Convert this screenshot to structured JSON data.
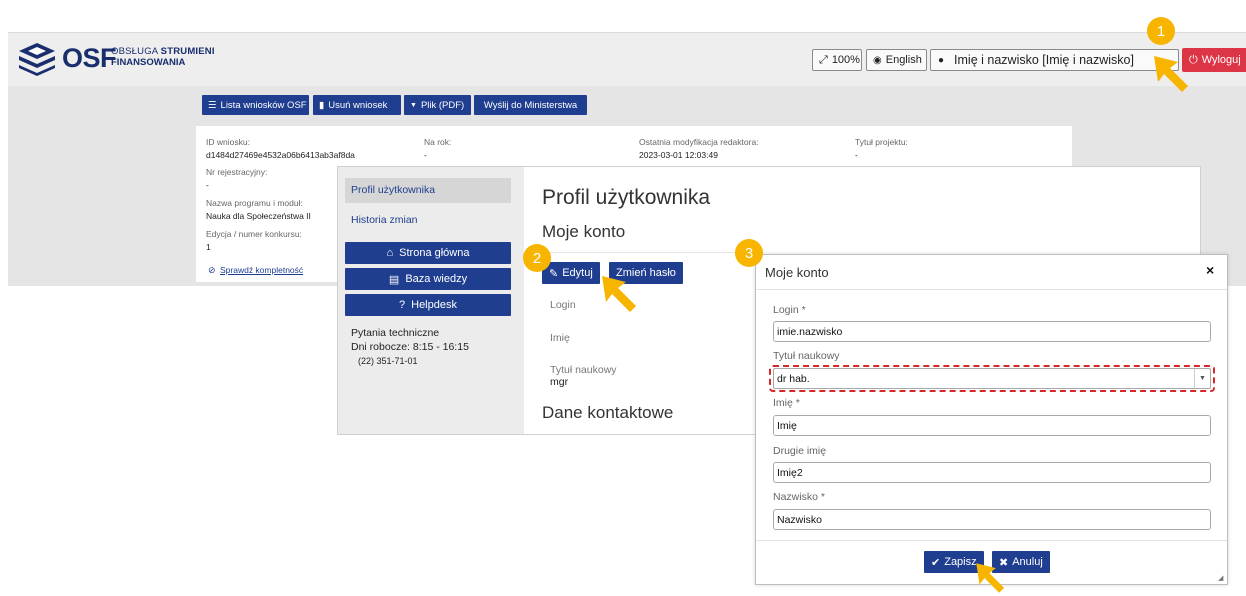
{
  "header": {
    "logo_text": "OSF",
    "logo_line1_light": "OBSŁUGA ",
    "logo_line1_bold": "STRUMIENI",
    "logo_line2": "FINANSOWANIA",
    "zoom": "100%",
    "language": "English",
    "user": "Imię i nazwisko [Imię i nazwisko]",
    "logout": "Wyloguj"
  },
  "toolbar": {
    "list": "Lista wniosków OSF",
    "delete": "Usuń wniosek",
    "file": "Plik (PDF)",
    "send": "Wyślij do Ministerstwa"
  },
  "info": {
    "id_label": "ID wniosku:",
    "id_value": "d1484d27469e4532a06b6413ab3af8da",
    "year_label": "Na rok:",
    "year_value": "-",
    "modified_label": "Ostatnia modyfikacja redaktora:",
    "modified_value": "2023-03-01 12:03:49",
    "project_label": "Tytuł projektu:",
    "project_value": "-",
    "reg_label": "Nr rejestracyjny:",
    "reg_value": "-",
    "program_label": "Nazwa programu i moduł:",
    "program_value": "Nauka dla Społeczeństwa II",
    "edition_label": "Edycja / numer konkursu:",
    "edition_value": "1",
    "check_link": "Sprawdź kompletność"
  },
  "sidebar": {
    "profile": "Profil użytkownika",
    "history": "Historia zmian",
    "home": "Strona główna",
    "knowledge": "Baza wiedzy",
    "helpdesk": "Helpdesk",
    "tech_title": "Pytania techniczne",
    "tech_hours": "Dni robocze: 8:15 - 16:15",
    "tech_phone": "(22) 351-71-01"
  },
  "profile": {
    "title": "Profil użytkownika",
    "account": "Moje konto",
    "edit": "Edytuj",
    "change_password": "Zmień hasło",
    "login_label": "Login",
    "name_label": "Imię",
    "degree_label": "Tytuł naukowy",
    "degree_value": "mgr",
    "contact": "Dane kontaktowe"
  },
  "modal": {
    "title": "Moje konto",
    "close": "×",
    "login_label": "Login *",
    "login_value": "imie.nazwisko",
    "degree_label": "Tytuł naukowy",
    "degree_value": "dr hab.",
    "name_label": "Imię *",
    "name_value": "Imię",
    "second_name_label": "Drugie imię",
    "second_name_value": "Imię2",
    "surname_label": "Nazwisko *",
    "surname_value": "Nazwisko",
    "save": "Zapisz",
    "cancel": "Anuluj"
  },
  "steps": {
    "one": "1",
    "two": "2",
    "three": "3"
  },
  "colors": {
    "primary": "#1f3e8f",
    "danger": "#dc3545",
    "marker": "#f7b500",
    "highlight": "#d62828"
  }
}
